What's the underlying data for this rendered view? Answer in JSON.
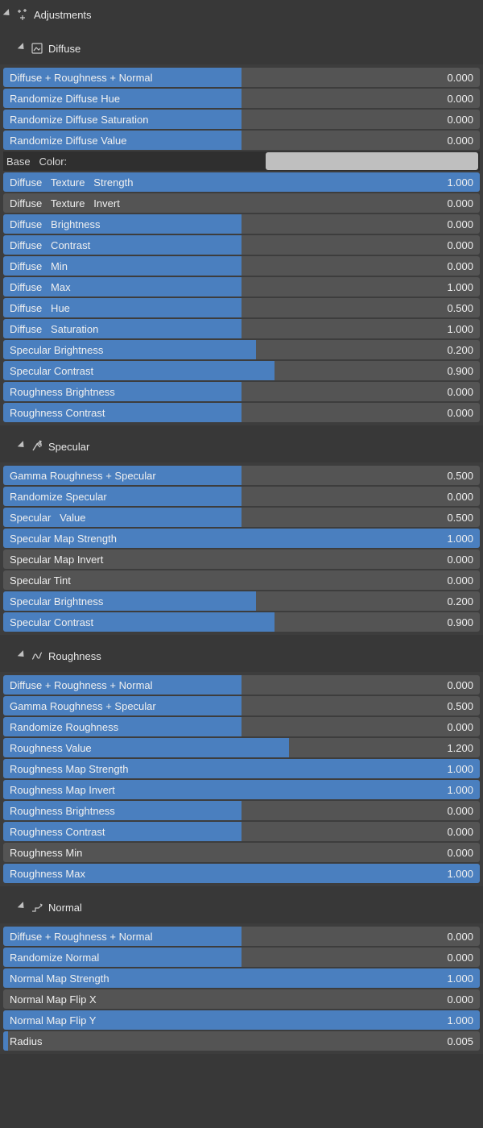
{
  "colors": {
    "accent": "#4a7fbf",
    "track": "#545454",
    "panel": "#383838",
    "body": "#3d3d3d",
    "text": "#e0e0e0",
    "swatch": "#bfbfbf"
  },
  "top_header": {
    "label": "Adjustments",
    "icon": "sparkle-icon"
  },
  "sections": [
    {
      "id": "diffuse",
      "label": "Diffuse",
      "icon": "image-frame-icon",
      "base_color": {
        "label": "Base   Color:",
        "value": "#bfbfbf"
      },
      "sliders_before_color": [
        {
          "label": "Diffuse + Roughness + Normal",
          "value": 0.0,
          "fill": 0.5
        },
        {
          "label": "Randomize Diffuse Hue",
          "value": 0.0,
          "fill": 0.5
        },
        {
          "label": "Randomize Diffuse Saturation",
          "value": 0.0,
          "fill": 0.5
        },
        {
          "label": "Randomize Diffuse Value",
          "value": 0.0,
          "fill": 0.5
        }
      ],
      "sliders_after_color": [
        {
          "label": "Diffuse   Texture   Strength",
          "value": 1.0,
          "fill": 1.0
        },
        {
          "label": "Diffuse   Texture   Invert",
          "value": 0.0,
          "fill": 0.0
        },
        {
          "label": "Diffuse   Brightness",
          "value": 0.0,
          "fill": 0.5
        },
        {
          "label": "Diffuse   Contrast",
          "value": 0.0,
          "fill": 0.5
        },
        {
          "label": "Diffuse   Min",
          "value": 0.0,
          "fill": 0.5
        },
        {
          "label": "Diffuse   Max",
          "value": 1.0,
          "fill": 0.5
        },
        {
          "label": "Diffuse   Hue",
          "value": 0.5,
          "fill": 0.5
        },
        {
          "label": "Diffuse   Saturation",
          "value": 1.0,
          "fill": 0.5
        },
        {
          "label": "Specular Brightness",
          "value": 0.2,
          "fill": 0.53
        },
        {
          "label": "Specular Contrast",
          "value": 0.9,
          "fill": 0.57
        },
        {
          "label": "Roughness Brightness",
          "value": 0.0,
          "fill": 0.5
        },
        {
          "label": "Roughness Contrast",
          "value": 0.0,
          "fill": 0.5
        }
      ]
    },
    {
      "id": "specular",
      "label": "Specular",
      "icon": "arrow-bounce-icon",
      "sliders": [
        {
          "label": "Gamma Roughness + Specular",
          "value": 0.5,
          "fill": 0.5
        },
        {
          "label": "Randomize Specular",
          "value": 0.0,
          "fill": 0.5
        },
        {
          "label": "Specular   Value",
          "value": 0.5,
          "fill": 0.5
        },
        {
          "label": "Specular Map Strength",
          "value": 1.0,
          "fill": 1.0
        },
        {
          "label": "Specular Map Invert",
          "value": 0.0,
          "fill": 0.0
        },
        {
          "label": "Specular Tint",
          "value": 0.0,
          "fill": 0.0
        },
        {
          "label": "Specular Brightness",
          "value": 0.2,
          "fill": 0.53
        },
        {
          "label": "Specular Contrast",
          "value": 0.9,
          "fill": 0.57
        }
      ]
    },
    {
      "id": "roughness",
      "label": "Roughness",
      "icon": "rough-line-icon",
      "sliders": [
        {
          "label": "Diffuse + Roughness + Normal",
          "value": 0.0,
          "fill": 0.5
        },
        {
          "label": "Gamma Roughness + Specular",
          "value": 0.5,
          "fill": 0.5
        },
        {
          "label": "Randomize Roughness",
          "value": 0.0,
          "fill": 0.5
        },
        {
          "label": "Roughness Value",
          "value": 1.2,
          "fill": 0.6
        },
        {
          "label": "Roughness Map Strength",
          "value": 1.0,
          "fill": 1.0
        },
        {
          "label": "Roughness Map Invert",
          "value": 1.0,
          "fill": 1.0
        },
        {
          "label": "Roughness Brightness",
          "value": 0.0,
          "fill": 0.5
        },
        {
          "label": "Roughness Contrast",
          "value": 0.0,
          "fill": 0.5
        },
        {
          "label": "Roughness Min",
          "value": 0.0,
          "fill": 0.0
        },
        {
          "label": "Roughness Max",
          "value": 1.0,
          "fill": 1.0
        }
      ]
    },
    {
      "id": "normal",
      "label": "Normal",
      "icon": "normal-ramp-icon",
      "sliders": [
        {
          "label": "Diffuse + Roughness + Normal",
          "value": 0.0,
          "fill": 0.5
        },
        {
          "label": "Randomize Normal",
          "value": 0.0,
          "fill": 0.5
        },
        {
          "label": "Normal Map Strength",
          "value": 1.0,
          "fill": 1.0
        },
        {
          "label": "Normal Map Flip X",
          "value": 0.0,
          "fill": 0.0
        },
        {
          "label": "Normal Map Flip Y",
          "value": 1.0,
          "fill": 1.0
        },
        {
          "label": "Radius",
          "value": 0.005,
          "fill": 0.01
        }
      ]
    }
  ]
}
